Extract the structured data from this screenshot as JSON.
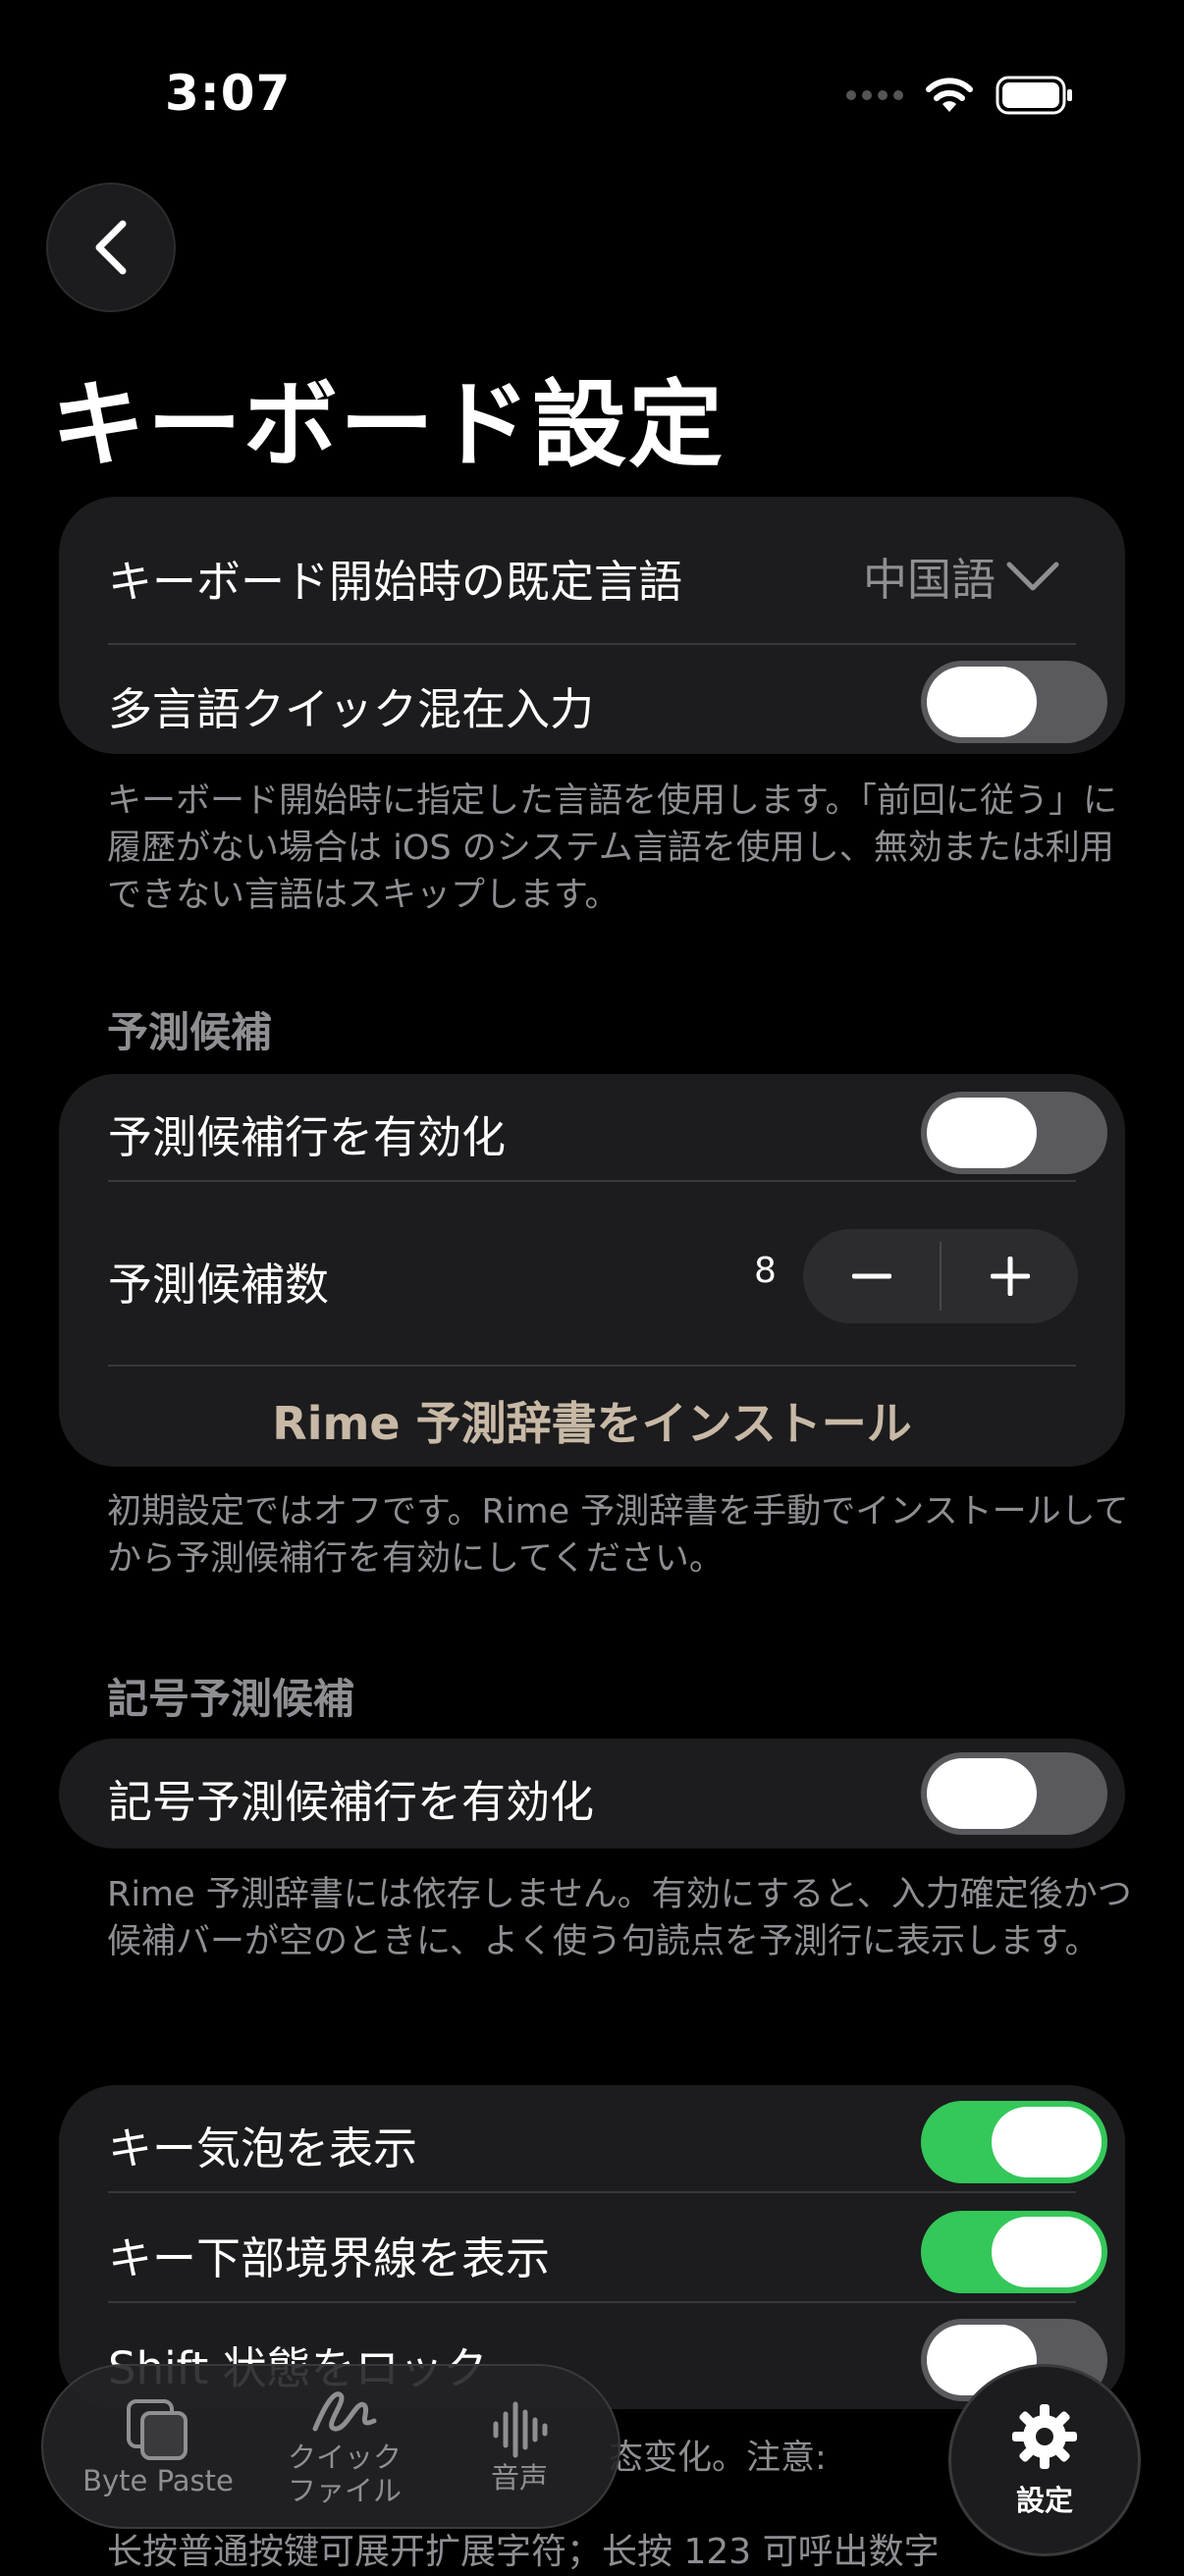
{
  "status_bar": {
    "time": "3:07"
  },
  "page": {
    "title": "キーボード設定"
  },
  "language_card": {
    "default_language_label": "キーボード開始時の既定言語",
    "default_language_value": "中国語",
    "multi_language_label": "多言語クイック混在入力",
    "multi_language_on": false
  },
  "language_footnote": "キーボード開始時に指定した言語を使用します。「前回に従う」に履歴がない場合は iOS のシステム言語を使用し、無効または利用できない言語はスキップします。",
  "prediction": {
    "header": "予測候補",
    "enable_label": "予測候補行を有効化",
    "enable_on": false,
    "count_label": "予測候補数",
    "count_value": "8",
    "install_label": "Rime 予測辞書をインストール",
    "footnote": "初期設定ではオフです。Rime 予測辞書を手動でインストールしてから予測候補行を有効にしてください。"
  },
  "symbol_prediction": {
    "header": "記号予測候補",
    "enable_label": "記号予測候補行を有効化",
    "enable_on": false,
    "footnote": "Rime 予測辞書には依存しません。有効にすると、入力確定後かつ候補バーが空のときに、よく使う句読点を予測行に表示します。"
  },
  "keys_card": {
    "key_bubble_label": "キー気泡を表示",
    "key_bubble_on": true,
    "key_border_label": "キー下部境界線を表示",
    "key_border_on": true,
    "shift_lock_label": "Shift 状態をロック",
    "shift_lock_on": false
  },
  "bottom_footnote": {
    "line1": "态变化。注意:",
    "line2": "长按普通按键可展开扩展字符；长按 123 可呼出数字"
  },
  "tab_bar": {
    "byte_paste": "Byte Paste",
    "quick_file_line1": "クイック",
    "quick_file_line2": "ファイル",
    "voice": "音声",
    "settings": "設定"
  },
  "colors": {
    "background": "#000000",
    "card": "#1c1c1e",
    "toggle_on": "#34c759",
    "toggle_off": "#5a5a5e",
    "secondary_text": "#8e8e93",
    "install_link": "#c8b9a6"
  }
}
